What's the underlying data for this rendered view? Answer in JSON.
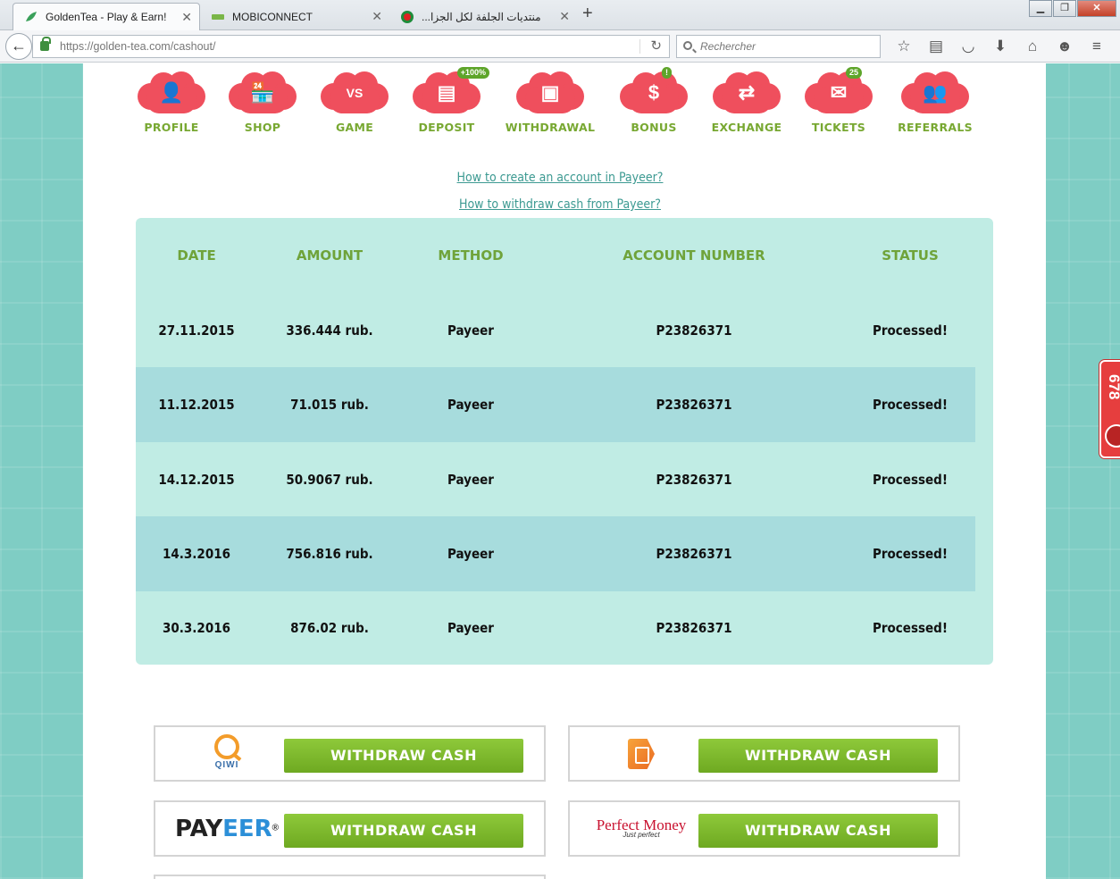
{
  "browser": {
    "tabs": [
      {
        "title": "GoldenTea - Play & Earn!",
        "active": true
      },
      {
        "title": "MOBICONNECT",
        "active": false
      },
      {
        "title": "منتديات الجلفة لكل الجزا...",
        "active": false
      }
    ],
    "url_base": "https://golden-tea.com",
    "url_path": "/cashout/",
    "search_placeholder": "Rechercher",
    "toolbar_icons": [
      "bookmark-star-icon",
      "reader-icon",
      "pocket-icon",
      "download-icon",
      "home-icon",
      "smiley-icon",
      "menu-icon"
    ]
  },
  "nav": [
    {
      "label": "PROFILE",
      "icon": "profile-icon",
      "glyph": "👤",
      "badge": ""
    },
    {
      "label": "SHOP",
      "icon": "shop-icon",
      "glyph": "🏪",
      "badge": ""
    },
    {
      "label": "GAME",
      "icon": "game-icon",
      "glyph": "VS",
      "badge": ""
    },
    {
      "label": "DEPOSIT",
      "icon": "deposit-icon",
      "glyph": "▤",
      "badge": "+100%"
    },
    {
      "label": "WITHDRAWAL",
      "icon": "wallet-icon",
      "glyph": "▣",
      "badge": ""
    },
    {
      "label": "BONUS",
      "icon": "bonus-icon",
      "glyph": "$",
      "badge": "!"
    },
    {
      "label": "EXCHANGE",
      "icon": "exchange-icon",
      "glyph": "⇄",
      "badge": ""
    },
    {
      "label": "TICKETS",
      "icon": "tickets-icon",
      "glyph": "✉",
      "badge": "25"
    },
    {
      "label": "REFERRALS",
      "icon": "referrals-icon",
      "glyph": "👥",
      "badge": ""
    }
  ],
  "help_links": [
    "How to create an account in Payeer?",
    "How to withdraw cash from Payeer?"
  ],
  "table": {
    "headers": [
      "DATE",
      "AMOUNT",
      "METHOD",
      "ACCOUNT NUMBER",
      "STATUS"
    ],
    "rows": [
      [
        "27.11.2015",
        "336.444 rub.",
        "Payeer",
        "P23826371",
        "Processed!"
      ],
      [
        "11.12.2015",
        "71.015 rub.",
        "Payeer",
        "P23826371",
        "Processed!"
      ],
      [
        "14.12.2015",
        "50.9067 rub.",
        "Payeer",
        "P23826371",
        "Processed!"
      ],
      [
        "14.3.2016",
        "756.816 rub.",
        "Payeer",
        "P23826371",
        "Processed!"
      ],
      [
        "30.3.2016",
        "876.02 rub.",
        "Payeer",
        "P23826371",
        "Processed!"
      ]
    ]
  },
  "withdraw": {
    "button_label": "WITHDRAW CASH",
    "methods": [
      {
        "logo": "qiwi-logo",
        "logo_text": "QIWI"
      },
      {
        "logo": "advcash-logo",
        "logo_text": ""
      },
      {
        "logo": "payeer-logo",
        "logo_text_a": "PAY",
        "logo_text_b": "EER",
        "logo_mark": "®"
      },
      {
        "logo": "perfect-money-logo",
        "logo_text": "Perfect Money",
        "logo_sub": "Just perfect"
      }
    ]
  },
  "side_widget": {
    "count": "678"
  },
  "colors": {
    "accent_green": "#78a832",
    "brand_red": "#ef4f5d",
    "table_bg": "#c0ece4",
    "link": "#3d9a92"
  }
}
